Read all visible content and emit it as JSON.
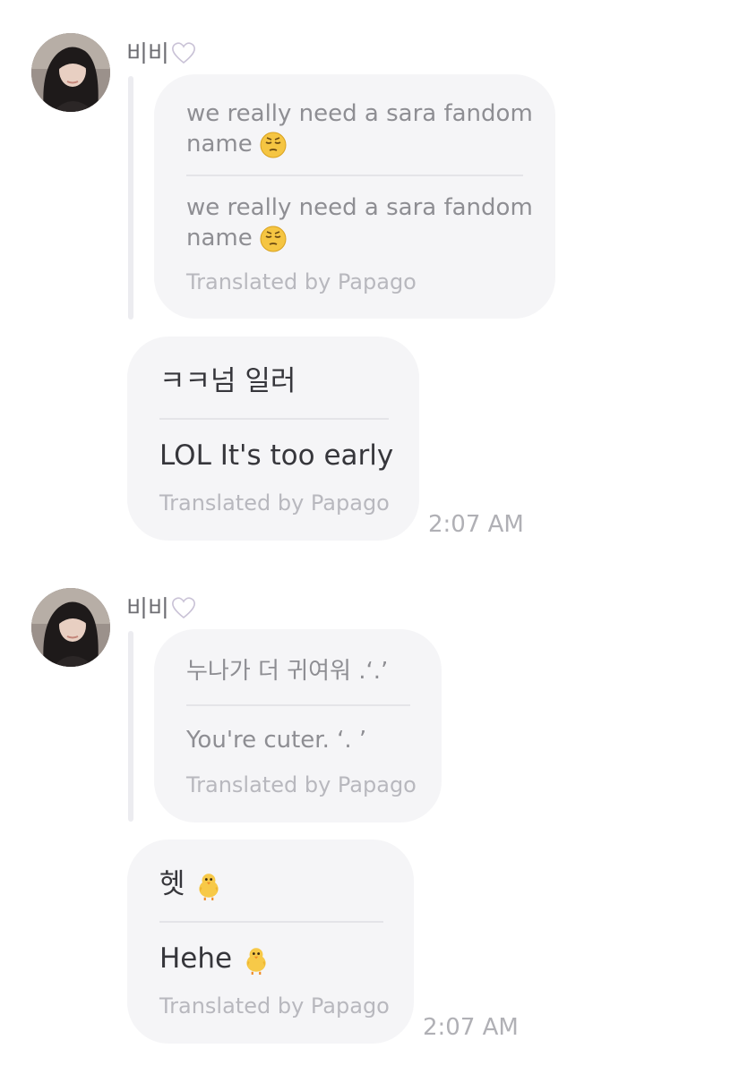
{
  "messages": [
    {
      "sender": "비비",
      "sender_icon": "white-heart-icon",
      "quote": {
        "original_line1": "we really need a sara fandom",
        "original_line2": "name",
        "original_emoji": "pensive-face-emoji",
        "translated_line1": "we really need a sara fandom",
        "translated_line2": "name",
        "translated_emoji": "pensive-face-emoji",
        "papago": "Translated by Papago"
      },
      "reply": {
        "original": "ㅋㅋ넘 일러",
        "translated": "LOL It's too early",
        "papago": "Translated by Papago"
      },
      "time": "2:07 AM"
    },
    {
      "sender": "비비",
      "sender_icon": "white-heart-icon",
      "quote": {
        "original_line1": "누나가 더 귀여워 .‘.’",
        "translated_line1": "You're cuter. ‘. ’",
        "papago": "Translated by Papago"
      },
      "reply": {
        "original": "헷",
        "original_emoji": "baby-chick-emoji",
        "translated": "Hehe",
        "translated_emoji": "baby-chick-emoji",
        "papago": "Translated by Papago"
      },
      "time": "2:07 AM"
    }
  ],
  "colors": {
    "bubble": "#f5f5f7",
    "separator": "#e4e4e8",
    "papago_text": "#b8b8be",
    "time_text": "#b0b0b5"
  }
}
